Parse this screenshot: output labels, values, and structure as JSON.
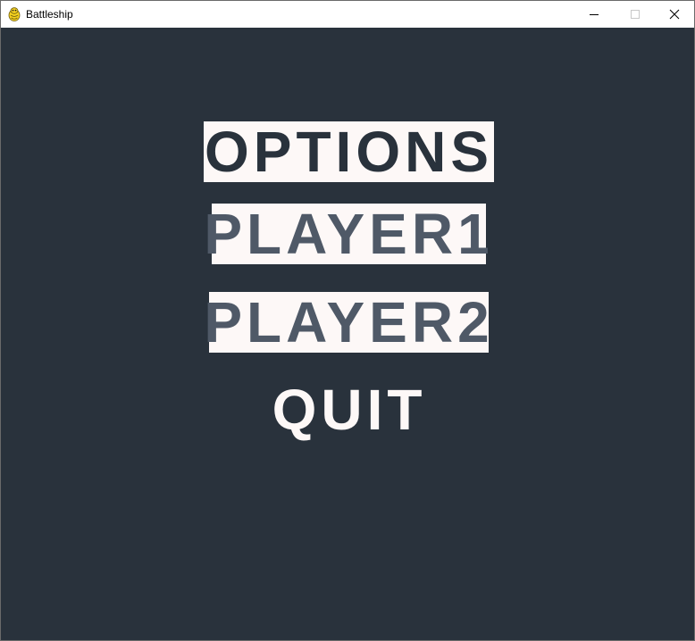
{
  "window": {
    "title": "Battleship",
    "icon": "pygame-snake-icon",
    "controls": {
      "minimize_icon": "minimize-icon",
      "maximize_icon": "maximize-icon",
      "close_icon": "close-icon"
    }
  },
  "menu": {
    "items": [
      {
        "label": "OPTIONS",
        "text_color": "#29323c",
        "bg_color": "#fdf8f7",
        "highlighted": true
      },
      {
        "label": "PLAYER1",
        "text_color": "#4f5967",
        "bg_color": "#fdf8f7",
        "highlighted": true
      },
      {
        "label": "PLAYER2",
        "text_color": "#4f5967",
        "bg_color": "#fdf8f7",
        "highlighted": true
      },
      {
        "label": "QUIT",
        "text_color": "#fdf8f7",
        "bg_color": "#29323c",
        "highlighted": false
      }
    ]
  },
  "colors": {
    "background": "#29323c",
    "titlebar": "#ffffff"
  }
}
